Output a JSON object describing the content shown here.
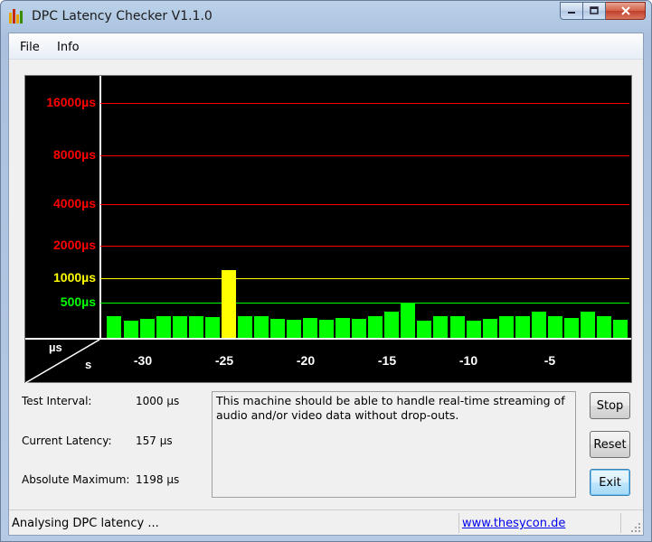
{
  "window": {
    "title": "DPC Latency Checker V1.1.0",
    "icon": "dpc-bar-chart-app-icon",
    "controls": {
      "minimize": "minimize-icon",
      "maximize": "maximize-icon",
      "close": "close-icon"
    }
  },
  "menu": {
    "file": "File",
    "info": "Info"
  },
  "graph": {
    "y_labels": [
      {
        "text": "16000µs",
        "color": "#ff0000"
      },
      {
        "text": "8000µs",
        "color": "#ff0000"
      },
      {
        "text": "4000µs",
        "color": "#ff0000"
      },
      {
        "text": "2000µs",
        "color": "#ff0000"
      },
      {
        "text": "1000µs",
        "color": "#ffff00"
      },
      {
        "text": "500µs",
        "color": "#00ff00"
      }
    ],
    "units_us": "µs",
    "units_s": "s",
    "x_ticks": [
      "-30",
      "-25",
      "-20",
      "-15",
      "-10",
      "-5"
    ],
    "colors": {
      "background": "#000000",
      "normal": "#00ff00",
      "warning": "#ffff00",
      "danger": "#ff0000",
      "axis": "#ffffff"
    }
  },
  "chart_data": {
    "type": "bar",
    "x": [
      -35,
      -34,
      -33,
      -32,
      -31,
      -30,
      -29,
      -28,
      -27,
      -26,
      -25,
      -24,
      -23,
      -22,
      -21,
      -20,
      -19,
      -18,
      -17,
      -16,
      -15,
      -14,
      -13,
      -12,
      -11,
      -10,
      -9,
      -8,
      -7,
      -6,
      -5,
      -4,
      -3,
      -2,
      -1,
      0
    ],
    "values": [
      190,
      200,
      150,
      170,
      200,
      200,
      200,
      190,
      1198,
      200,
      200,
      170,
      160,
      180,
      160,
      180,
      170,
      200,
      270,
      470,
      150,
      200,
      200,
      150,
      170,
      200,
      200,
      270,
      210,
      180,
      270,
      200,
      157
    ],
    "ylabel_unit": "µs",
    "yticks": [
      500,
      1000,
      2000,
      4000,
      8000,
      16000
    ],
    "y_scale": "log",
    "xticks": [
      -30,
      -25,
      -20,
      -15,
      -10,
      -5
    ],
    "xlabel_unit": "s",
    "grid": true
  },
  "info": {
    "test_interval_label": "Test Interval:",
    "test_interval_value": "1000 µs",
    "current_latency_label": "Current Latency:",
    "current_latency_value": "157 µs",
    "absolute_maximum_label": "Absolute Maximum:",
    "absolute_maximum_value": "1198 µs"
  },
  "message": "This machine should be able to handle real-time streaming of audio and/or video data without drop-outs.",
  "buttons": {
    "stop": "Stop",
    "reset": "Reset",
    "exit": "Exit"
  },
  "status": {
    "text": "Analysing DPC latency ...",
    "link": "www.thesycon.de"
  }
}
